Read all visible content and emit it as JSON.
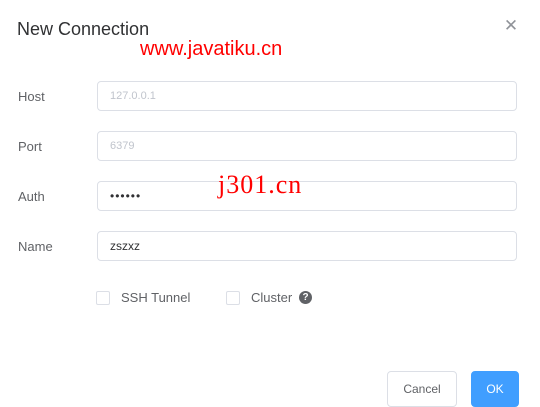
{
  "dialog": {
    "title": "New Connection",
    "close_icon": "close-icon"
  },
  "watermarks": {
    "primary": "www.javatiku.cn",
    "secondary": "j301.cn"
  },
  "form": {
    "host": {
      "label": "Host",
      "placeholder": "127.0.0.1",
      "value": ""
    },
    "port": {
      "label": "Port",
      "placeholder": "6379",
      "value": ""
    },
    "auth": {
      "label": "Auth",
      "value": "••••••"
    },
    "name": {
      "label": "Name",
      "value": "zszxz"
    }
  },
  "options": {
    "ssh_tunnel": {
      "label": "SSH Tunnel",
      "checked": false
    },
    "cluster": {
      "label": "Cluster",
      "checked": false,
      "help_icon": "question-circle-icon"
    }
  },
  "buttons": {
    "cancel": "Cancel",
    "ok": "OK"
  },
  "colors": {
    "primary": "#409eff",
    "watermark": "#ff0000",
    "border": "#dcdfe6",
    "text": "#606266"
  }
}
